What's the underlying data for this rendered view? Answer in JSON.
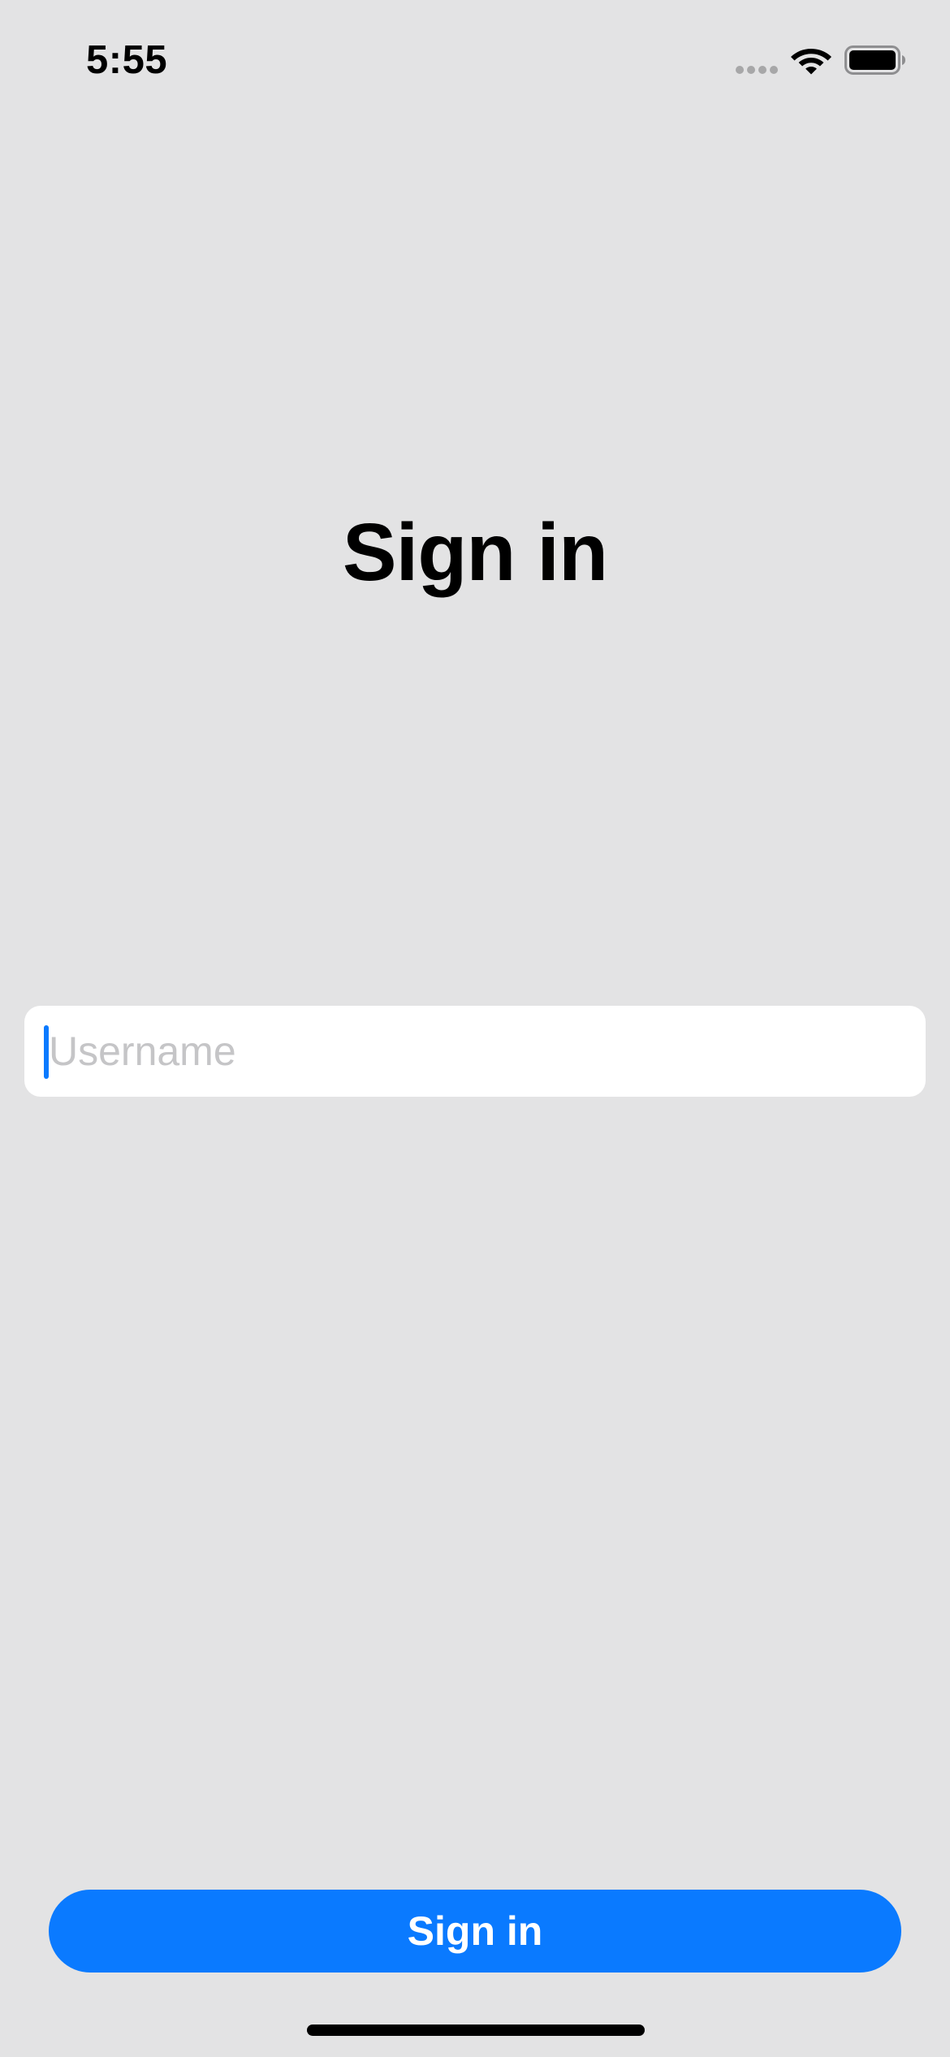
{
  "status_bar": {
    "time": "5:55",
    "signal_icon": "cellular-signal-icon",
    "wifi_icon": "wifi-icon",
    "battery_icon": "battery-icon"
  },
  "title": "Sign in",
  "username_field": {
    "placeholder": "Username",
    "value": ""
  },
  "signin_button": {
    "label": "Sign in"
  },
  "colors": {
    "background": "#e3e3e4",
    "accent": "#0a7aff",
    "field_background": "#ffffff",
    "placeholder": "#c5c5c7"
  }
}
